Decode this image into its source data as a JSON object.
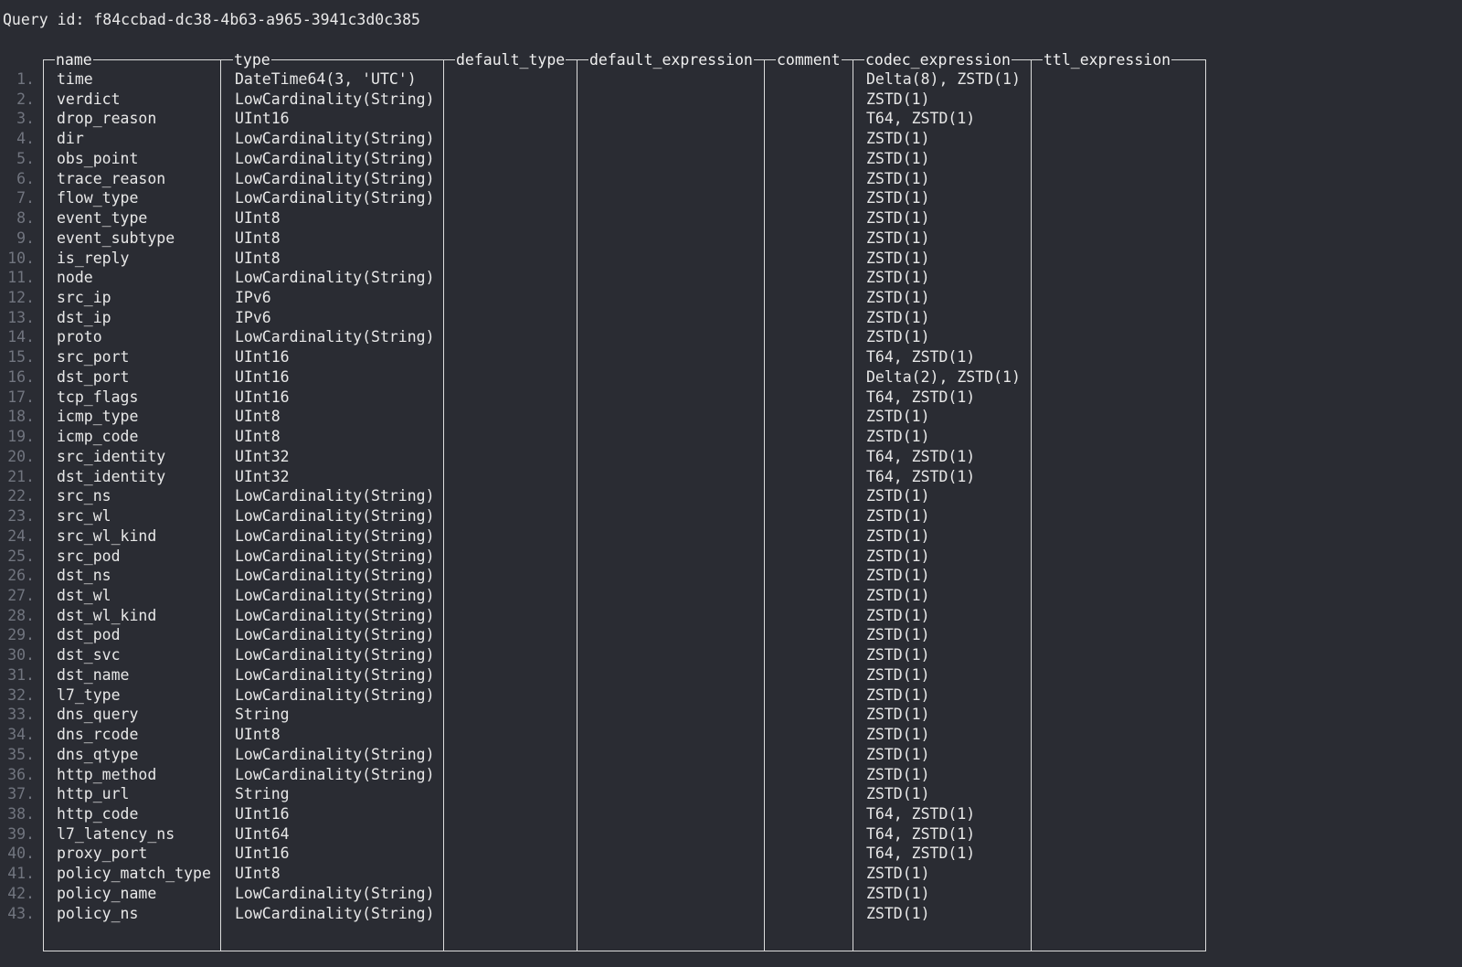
{
  "query": {
    "label": "Query id: f84ccbad-dc38-4b63-a965-3941c3d0c385"
  },
  "table": {
    "columns": [
      "name",
      "type",
      "default_type",
      "default_expression",
      "comment",
      "codec_expression",
      "ttl_expression"
    ],
    "rows": [
      {
        "num": "1.",
        "name": "time",
        "type": "DateTime64(3, 'UTC')",
        "codec": "Delta(8), ZSTD(1)"
      },
      {
        "num": "2.",
        "name": "verdict",
        "type": "LowCardinality(String)",
        "codec": "ZSTD(1)"
      },
      {
        "num": "3.",
        "name": "drop_reason",
        "type": "UInt16",
        "codec": "T64, ZSTD(1)"
      },
      {
        "num": "4.",
        "name": "dir",
        "type": "LowCardinality(String)",
        "codec": "ZSTD(1)"
      },
      {
        "num": "5.",
        "name": "obs_point",
        "type": "LowCardinality(String)",
        "codec": "ZSTD(1)"
      },
      {
        "num": "6.",
        "name": "trace_reason",
        "type": "LowCardinality(String)",
        "codec": "ZSTD(1)"
      },
      {
        "num": "7.",
        "name": "flow_type",
        "type": "LowCardinality(String)",
        "codec": "ZSTD(1)"
      },
      {
        "num": "8.",
        "name": "event_type",
        "type": "UInt8",
        "codec": "ZSTD(1)"
      },
      {
        "num": "9.",
        "name": "event_subtype",
        "type": "UInt8",
        "codec": "ZSTD(1)"
      },
      {
        "num": "10.",
        "name": "is_reply",
        "type": "UInt8",
        "codec": "ZSTD(1)"
      },
      {
        "num": "11.",
        "name": "node",
        "type": "LowCardinality(String)",
        "codec": "ZSTD(1)"
      },
      {
        "num": "12.",
        "name": "src_ip",
        "type": "IPv6",
        "codec": "ZSTD(1)"
      },
      {
        "num": "13.",
        "name": "dst_ip",
        "type": "IPv6",
        "codec": "ZSTD(1)"
      },
      {
        "num": "14.",
        "name": "proto",
        "type": "LowCardinality(String)",
        "codec": "ZSTD(1)"
      },
      {
        "num": "15.",
        "name": "src_port",
        "type": "UInt16",
        "codec": "T64, ZSTD(1)"
      },
      {
        "num": "16.",
        "name": "dst_port",
        "type": "UInt16",
        "codec": "Delta(2), ZSTD(1)"
      },
      {
        "num": "17.",
        "name": "tcp_flags",
        "type": "UInt16",
        "codec": "T64, ZSTD(1)"
      },
      {
        "num": "18.",
        "name": "icmp_type",
        "type": "UInt8",
        "codec": "ZSTD(1)"
      },
      {
        "num": "19.",
        "name": "icmp_code",
        "type": "UInt8",
        "codec": "ZSTD(1)"
      },
      {
        "num": "20.",
        "name": "src_identity",
        "type": "UInt32",
        "codec": "T64, ZSTD(1)"
      },
      {
        "num": "21.",
        "name": "dst_identity",
        "type": "UInt32",
        "codec": "T64, ZSTD(1)"
      },
      {
        "num": "22.",
        "name": "src_ns",
        "type": "LowCardinality(String)",
        "codec": "ZSTD(1)"
      },
      {
        "num": "23.",
        "name": "src_wl",
        "type": "LowCardinality(String)",
        "codec": "ZSTD(1)"
      },
      {
        "num": "24.",
        "name": "src_wl_kind",
        "type": "LowCardinality(String)",
        "codec": "ZSTD(1)"
      },
      {
        "num": "25.",
        "name": "src_pod",
        "type": "LowCardinality(String)",
        "codec": "ZSTD(1)"
      },
      {
        "num": "26.",
        "name": "dst_ns",
        "type": "LowCardinality(String)",
        "codec": "ZSTD(1)"
      },
      {
        "num": "27.",
        "name": "dst_wl",
        "type": "LowCardinality(String)",
        "codec": "ZSTD(1)"
      },
      {
        "num": "28.",
        "name": "dst_wl_kind",
        "type": "LowCardinality(String)",
        "codec": "ZSTD(1)"
      },
      {
        "num": "29.",
        "name": "dst_pod",
        "type": "LowCardinality(String)",
        "codec": "ZSTD(1)"
      },
      {
        "num": "30.",
        "name": "dst_svc",
        "type": "LowCardinality(String)",
        "codec": "ZSTD(1)"
      },
      {
        "num": "31.",
        "name": "dst_name",
        "type": "LowCardinality(String)",
        "codec": "ZSTD(1)"
      },
      {
        "num": "32.",
        "name": "l7_type",
        "type": "LowCardinality(String)",
        "codec": "ZSTD(1)"
      },
      {
        "num": "33.",
        "name": "dns_query",
        "type": "String",
        "codec": "ZSTD(1)"
      },
      {
        "num": "34.",
        "name": "dns_rcode",
        "type": "UInt8",
        "codec": "ZSTD(1)"
      },
      {
        "num": "35.",
        "name": "dns_qtype",
        "type": "LowCardinality(String)",
        "codec": "ZSTD(1)"
      },
      {
        "num": "36.",
        "name": "http_method",
        "type": "LowCardinality(String)",
        "codec": "ZSTD(1)"
      },
      {
        "num": "37.",
        "name": "http_url",
        "type": "String",
        "codec": "ZSTD(1)"
      },
      {
        "num": "38.",
        "name": "http_code",
        "type": "UInt16",
        "codec": "T64, ZSTD(1)"
      },
      {
        "num": "39.",
        "name": "l7_latency_ns",
        "type": "UInt64",
        "codec": "T64, ZSTD(1)"
      },
      {
        "num": "40.",
        "name": "proxy_port",
        "type": "UInt16",
        "codec": "T64, ZSTD(1)"
      },
      {
        "num": "41.",
        "name": "policy_match_type",
        "type": "UInt8",
        "codec": "ZSTD(1)"
      },
      {
        "num": "42.",
        "name": "policy_name",
        "type": "LowCardinality(String)",
        "codec": "ZSTD(1)"
      },
      {
        "num": "43.",
        "name": "policy_ns",
        "type": "LowCardinality(String)",
        "codec": "ZSTD(1)"
      }
    ]
  },
  "colors": {
    "background": "#2a2c33",
    "text": "#e8e8e8",
    "row_number": "#71757f",
    "border": "#dcdcdc"
  }
}
